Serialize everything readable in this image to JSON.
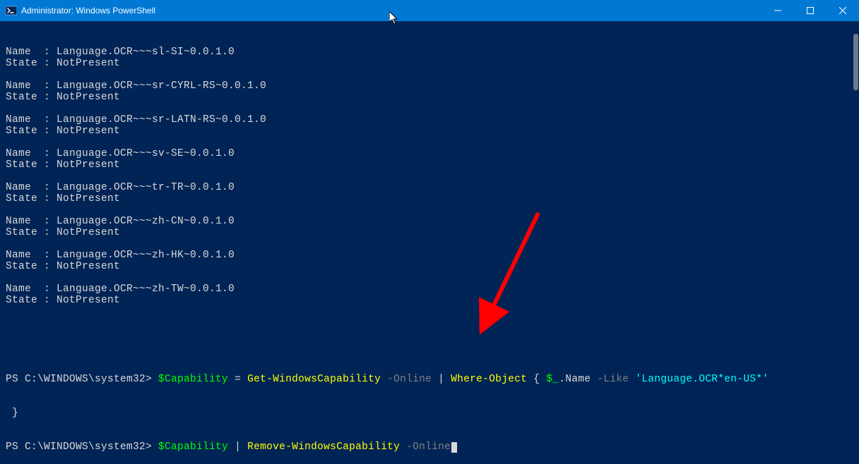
{
  "window": {
    "title": "Administrator: Windows PowerShell"
  },
  "output": {
    "entries": [
      {
        "name": "Language.OCR~~~sl-SI~0.0.1.0",
        "state": "NotPresent"
      },
      {
        "name": "Language.OCR~~~sr-CYRL-RS~0.0.1.0",
        "state": "NotPresent"
      },
      {
        "name": "Language.OCR~~~sr-LATN-RS~0.0.1.0",
        "state": "NotPresent"
      },
      {
        "name": "Language.OCR~~~sv-SE~0.0.1.0",
        "state": "NotPresent"
      },
      {
        "name": "Language.OCR~~~tr-TR~0.0.1.0",
        "state": "NotPresent"
      },
      {
        "name": "Language.OCR~~~zh-CN~0.0.1.0",
        "state": "NotPresent"
      },
      {
        "name": "Language.OCR~~~zh-HK~0.0.1.0",
        "state": "NotPresent"
      },
      {
        "name": "Language.OCR~~~zh-TW~0.0.1.0",
        "state": "NotPresent"
      }
    ],
    "name_label": "Name  : ",
    "state_label": "State : "
  },
  "prompts": {
    "path": "PS C:\\WINDOWS\\system32> ",
    "line1": {
      "variable": "$Capability",
      "assign": " = ",
      "cmdlet": "Get-WindowsCapability",
      "param1": " -Online",
      "pipe1": " | ",
      "cmdlet2": "Where-Object",
      "block_open": " { ",
      "var2": "$_",
      "prop": ".Name ",
      "param2": "-Like ",
      "string": "'Language.OCR*en-US*'",
      "block_close_line2": " }"
    },
    "line2": {
      "variable": "$Capability",
      "pipe": " | ",
      "cmdlet": "Remove-WindowsCapability",
      "param": " -Online"
    }
  }
}
